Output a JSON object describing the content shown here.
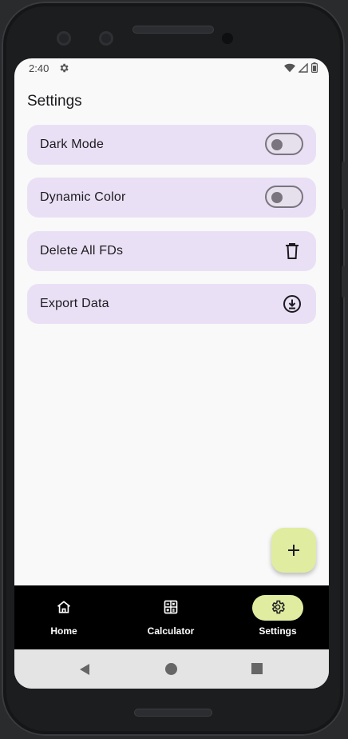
{
  "status_bar": {
    "time": "2:40"
  },
  "page": {
    "title": "Settings"
  },
  "settings": [
    {
      "label": "Dark Mode",
      "control": "switch",
      "on": false
    },
    {
      "label": "Dynamic Color",
      "control": "switch",
      "on": false
    },
    {
      "label": "Delete All FDs",
      "control": "icon",
      "icon": "trash-icon"
    },
    {
      "label": "Export Data",
      "control": "icon",
      "icon": "download-circle-icon"
    }
  ],
  "fab": {
    "icon": "plus-icon"
  },
  "bottom_nav": {
    "items": [
      {
        "label": "Home",
        "icon": "home-icon",
        "active": false
      },
      {
        "label": "Calculator",
        "icon": "calculator-icon",
        "active": false
      },
      {
        "label": "Settings",
        "icon": "gear-icon",
        "active": true
      }
    ]
  },
  "colors": {
    "card_bg": "#e9e0f5",
    "accent": "#e0eca0",
    "nav_bg": "#000000",
    "screen_bg": "#f9f9f9"
  }
}
